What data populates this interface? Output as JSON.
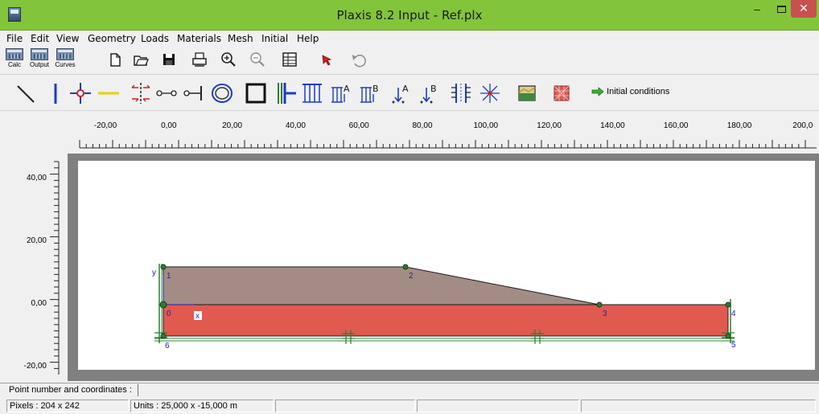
{
  "window": {
    "title": "Plaxis 8.2 Input - Ref.plx",
    "minimize": "–",
    "close": "✕"
  },
  "menu": [
    "File",
    "Edit",
    "View",
    "Geometry",
    "Loads",
    "Materials",
    "Mesh",
    "Initial",
    "Help"
  ],
  "program_buttons": [
    {
      "label": "Calc",
      "icon": "calculations-program-icon"
    },
    {
      "label": "Output",
      "icon": "output-program-icon"
    },
    {
      "label": "Curves",
      "icon": "curves-program-icon"
    }
  ],
  "initial_conditions_label": "Initial conditions",
  "ruler": {
    "x_labels": [
      "-20,00",
      "0,00",
      "20,00",
      "40,00",
      "60,00",
      "80,00",
      "100,00",
      "120,00",
      "140,00",
      "160,00",
      "180,00",
      "200,0"
    ],
    "y_labels": [
      "40,00",
      "20,00",
      "0,00",
      "-20,00"
    ]
  },
  "geometry": {
    "points": [
      "0",
      "1",
      "2",
      "3",
      "4",
      "5",
      "6"
    ],
    "axis_x": "x",
    "axis_y": "y",
    "colors": {
      "embankment": "#a38c83",
      "foundation": "#e05a50",
      "line": "#1a1a1a",
      "point": "#2e7d32",
      "point_label": "#2222aa"
    }
  },
  "coord_prompt": "Point number and coordinates :",
  "status": {
    "pixels": "Pixels : 204 x 242",
    "units": "Units  : 25,000 x -15,000 m"
  }
}
